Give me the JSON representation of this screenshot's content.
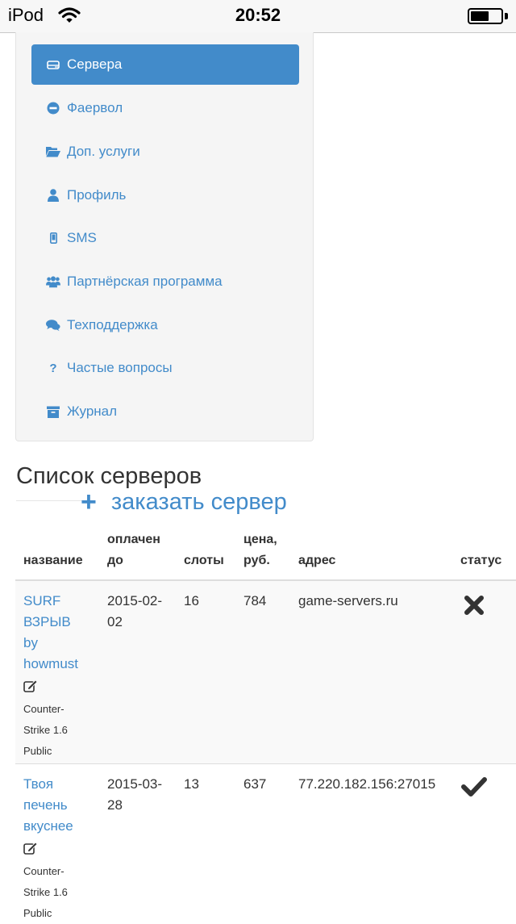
{
  "status_bar": {
    "carrier": "iPod",
    "time": "20:52",
    "battery_level": 0.6
  },
  "menu": {
    "items": [
      {
        "label": "Сервера",
        "icon": "server-icon",
        "active": true
      },
      {
        "label": "Фаервол",
        "icon": "minus-circle-icon",
        "active": false
      },
      {
        "label": "Доп. услуги",
        "icon": "folder-open-icon",
        "active": false
      },
      {
        "label": "Профиль",
        "icon": "user-icon",
        "active": false
      },
      {
        "label": "SMS",
        "icon": "phone-icon",
        "active": false
      },
      {
        "label": "Партнёрская программа",
        "icon": "users-icon",
        "active": false
      },
      {
        "label": "Техподдержка",
        "icon": "comments-icon",
        "active": false
      },
      {
        "label": "Частые вопросы",
        "icon": "question-icon",
        "active": false
      },
      {
        "label": "Журнал",
        "icon": "archive-icon",
        "active": false
      }
    ]
  },
  "page": {
    "title": "Список серверов",
    "order_plus": "+",
    "order_label": "заказать сервер"
  },
  "table": {
    "headers": {
      "name": "название",
      "paid_line1": "оплачен",
      "paid_line2": "до",
      "slots": "слоты",
      "price_line1": "цена,",
      "price_line2": "руб.",
      "address": "адрес",
      "status": "статус"
    },
    "rows": [
      {
        "name_lines": [
          "SURF",
          "ВЗРЫВ",
          "by",
          "howmust"
        ],
        "game_lines": [
          "Counter-",
          "Strike 1.6",
          "Public"
        ],
        "paid_lines": [
          "2015-02-",
          "02"
        ],
        "slots": "16",
        "price": "784",
        "address": "game-servers.ru",
        "status": "stopped",
        "status_icon": "x-icon"
      },
      {
        "name_lines": [
          "Твоя",
          "печень",
          "вкуснее"
        ],
        "game_lines": [
          "Counter-",
          "Strike 1.6",
          "Public"
        ],
        "paid_lines": [
          "2015-03-",
          "28"
        ],
        "slots": "13",
        "price": "637",
        "address": "77.220.182.156:27015",
        "status": "running",
        "status_icon": "check-icon"
      }
    ]
  },
  "colors": {
    "accent": "#428bca",
    "menu_bg": "#f5f5f5",
    "text": "#333333"
  }
}
